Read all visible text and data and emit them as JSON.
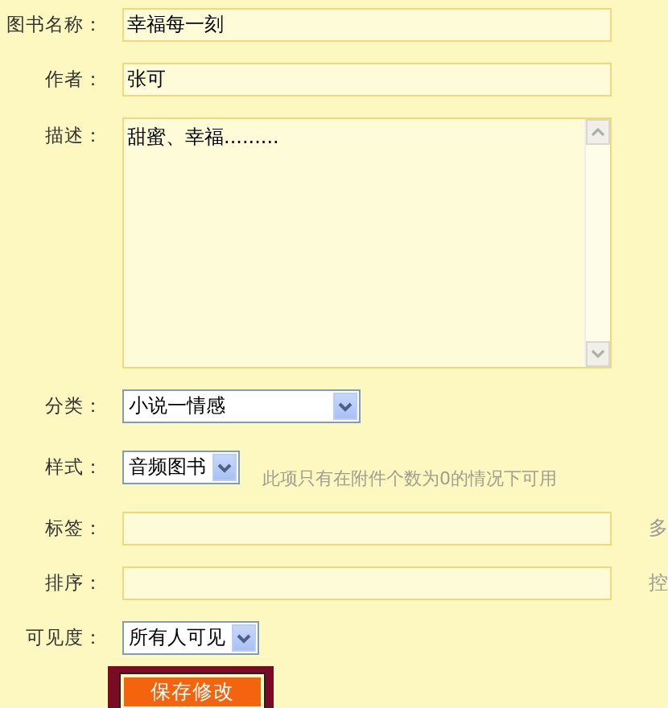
{
  "form": {
    "fields": [
      {
        "kind": "text",
        "label": "图书名称：",
        "value": "幸福每一刻"
      },
      {
        "kind": "text",
        "label": "作者：",
        "value": "张可"
      },
      {
        "kind": "textarea",
        "label": "描述：",
        "value": "甜蜜、幸福........."
      },
      {
        "kind": "select",
        "label": "分类：",
        "value": "小说一情感"
      },
      {
        "kind": "select",
        "label": "样式：",
        "value": "音频图书",
        "hint": "此项只有在附件个数为0的情况下可用"
      },
      {
        "kind": "text",
        "label": "标签：",
        "side_note": "多"
      },
      {
        "kind": "text",
        "label": "排序：",
        "side_note": "控"
      },
      {
        "kind": "select",
        "label": "可见度：",
        "value": "所有人可见"
      }
    ]
  },
  "submit_button": "保存修改"
}
